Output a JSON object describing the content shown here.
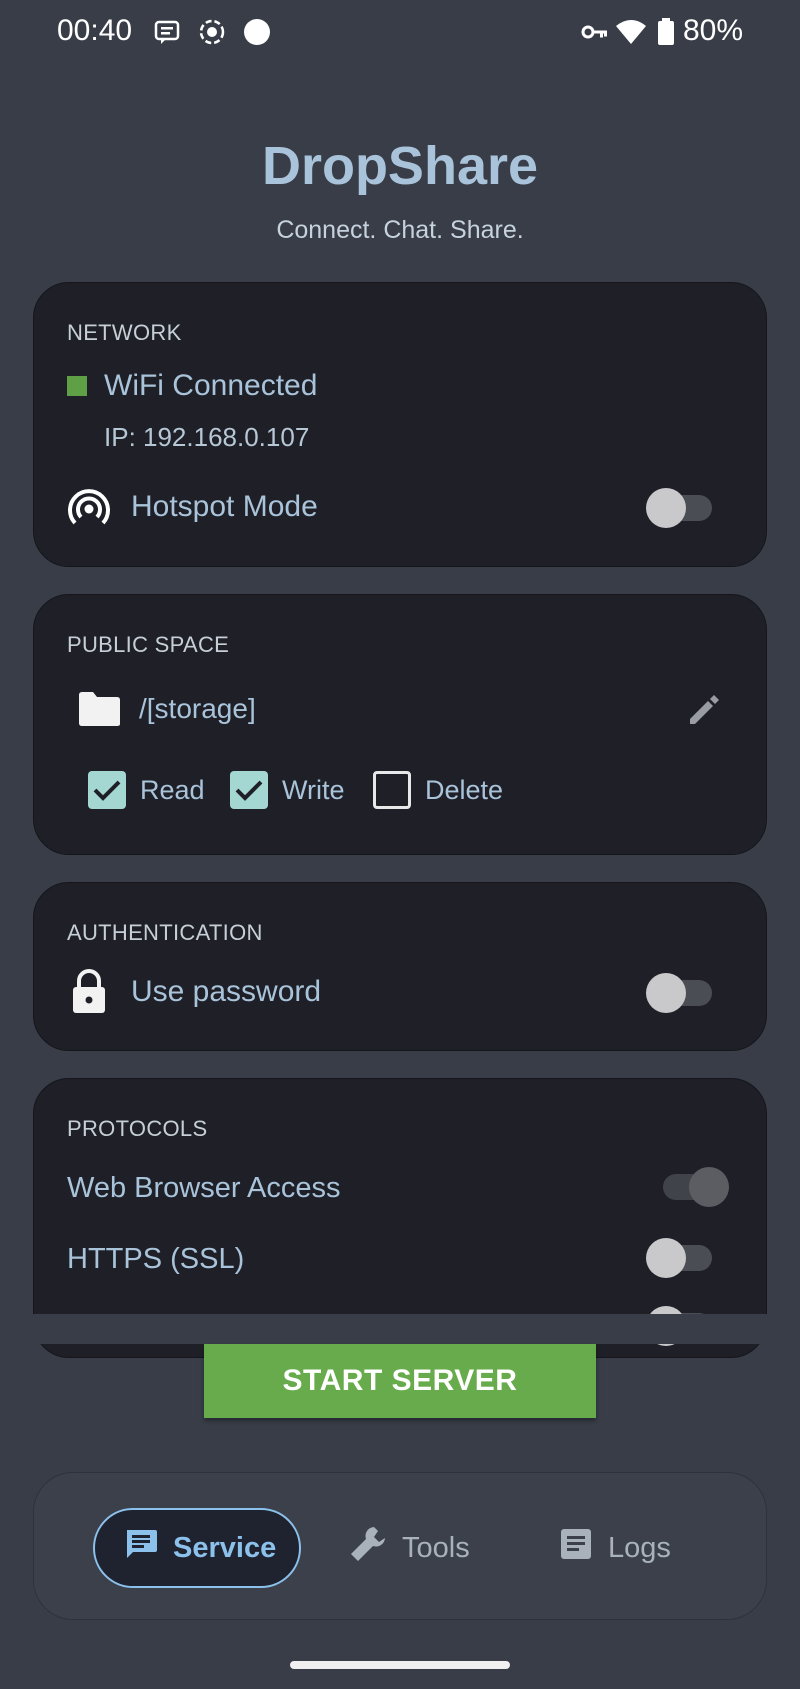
{
  "status_bar": {
    "time": "00:40",
    "battery": "80%",
    "icons": [
      "message-icon",
      "screen-record-icon",
      "dot-icon",
      "vpn-key-icon",
      "wifi-icon",
      "battery-icon"
    ]
  },
  "header": {
    "title": "DropShare",
    "subtitle": "Connect. Chat. Share."
  },
  "network": {
    "section_label": "NETWORK",
    "status": "WiFi Connected",
    "status_color": "#5fa046",
    "ip": "IP: 192.168.0.107",
    "hotspot_label": "Hotspot Mode",
    "hotspot_on": false
  },
  "public_space": {
    "section_label": "PUBLIC SPACE",
    "path": "/[storage]",
    "permissions": [
      {
        "label": "Read",
        "checked": true
      },
      {
        "label": "Write",
        "checked": true
      },
      {
        "label": "Delete",
        "checked": false
      }
    ]
  },
  "authentication": {
    "section_label": "AUTHENTICATION",
    "password_label": "Use password",
    "password_on": false
  },
  "protocols": {
    "section_label": "PROTOCOLS",
    "items": [
      {
        "label": "Web Browser Access",
        "on": true
      },
      {
        "label": "HTTPS (SSL)",
        "on": false
      }
    ]
  },
  "start_button": "START SERVER",
  "start_button_color": "#67ab4c",
  "nav": {
    "items": [
      {
        "label": "Service",
        "icon": "chat-icon",
        "active": true
      },
      {
        "label": "Tools",
        "icon": "wrench-icon",
        "active": false
      },
      {
        "label": "Logs",
        "icon": "document-icon",
        "active": false
      }
    ]
  }
}
